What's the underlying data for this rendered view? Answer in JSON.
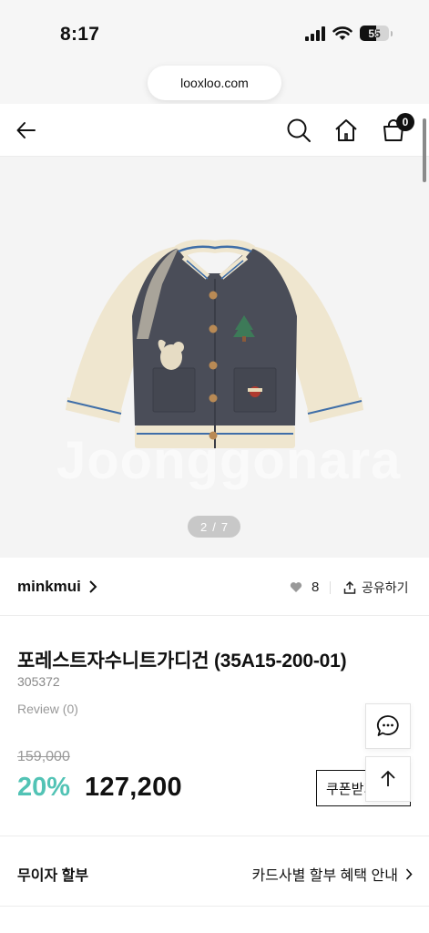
{
  "status_bar": {
    "time": "8:17",
    "battery": "55"
  },
  "browser": {
    "url": "looxloo.com"
  },
  "header": {
    "cart_count": "0"
  },
  "gallery": {
    "current": "2",
    "separator": "/",
    "total": "7",
    "watermark": "Joonggonara"
  },
  "brand": {
    "name": "minkmui",
    "likes": "8",
    "share_label": "공유하기"
  },
  "product": {
    "title": "포레스트자수니트가디건 (35A15-200-01)",
    "code": "305372",
    "review": "Review (0)",
    "original_price": "159,000",
    "discount": "20%",
    "sale_price": "127,200",
    "coupon_label": "쿠폰받기"
  },
  "installment": {
    "label": "무이자 할부",
    "link": "카드사별 할부 혜택 안내"
  },
  "colors": {
    "accent": "#52c3b5",
    "body_knit": "#4a4d58",
    "cream_knit": "#efe6cf",
    "stripe": "#3f6ea8"
  }
}
